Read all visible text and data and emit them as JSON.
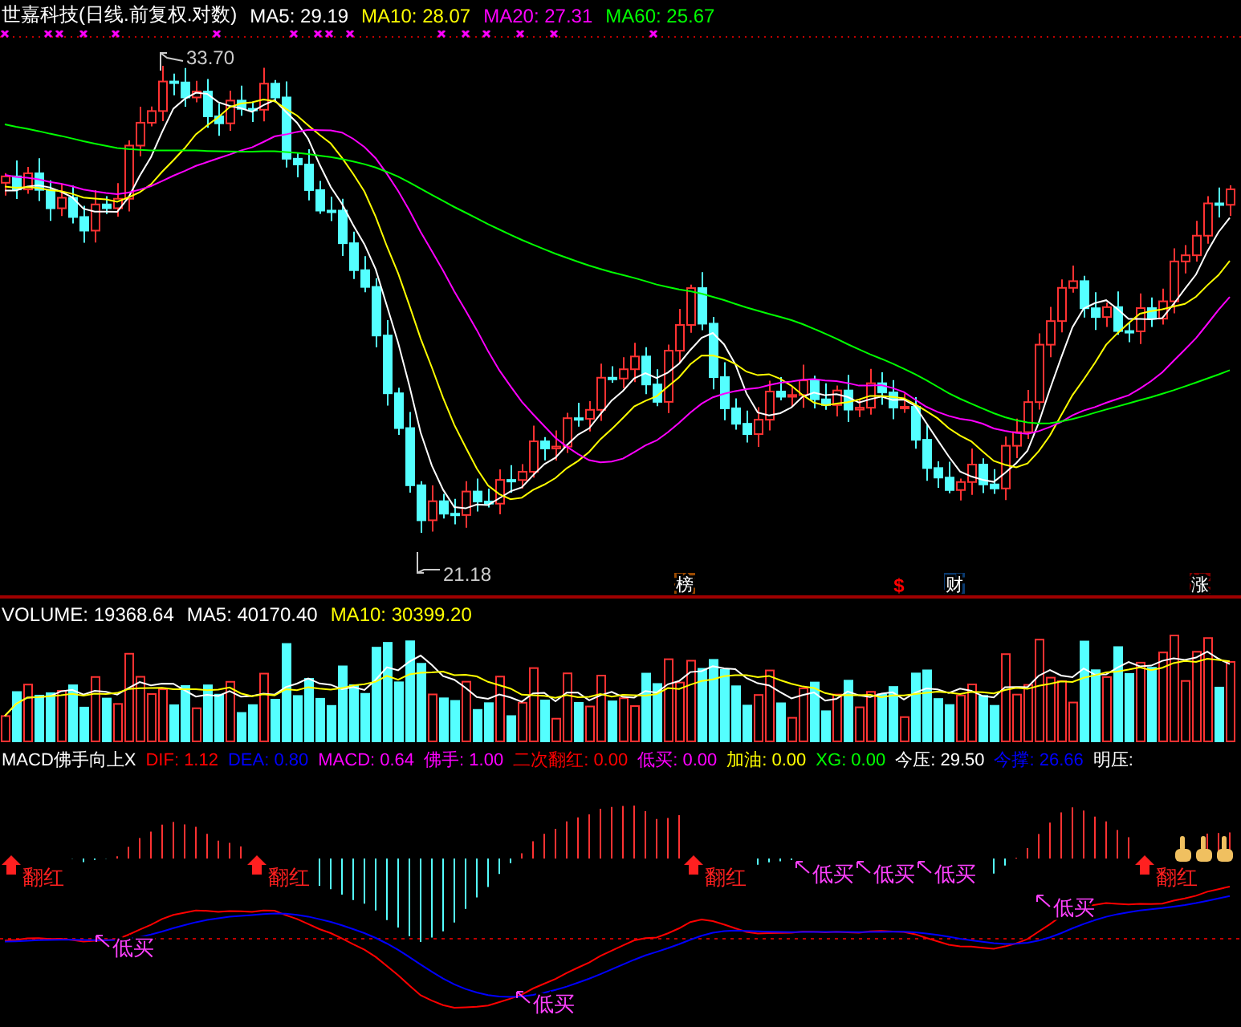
{
  "price_header": {
    "title": "世嘉科技(日线.前复权.对数)",
    "indicators": [
      {
        "label": "MA5: 29.19",
        "color": "#ffffff"
      },
      {
        "label": "MA10: 28.07",
        "color": "#ffff00"
      },
      {
        "label": "MA20: 27.31",
        "color": "#ff00ff"
      },
      {
        "label": "MA60: 25.67",
        "color": "#00ff00"
      }
    ]
  },
  "price_chart": {
    "high_label": "33.70",
    "low_label": "21.18",
    "event_tags": [
      {
        "text": "榜",
        "kind": "box",
        "color": "#9c4a00"
      },
      {
        "text": "$",
        "kind": "plain",
        "color": "#ff0000"
      },
      {
        "text": "财",
        "kind": "box",
        "color": "#0a3a70"
      },
      {
        "text": "涨",
        "kind": "box",
        "color": "#800000"
      }
    ]
  },
  "volume_header": {
    "indicators": [
      {
        "label": "VOLUME: 19368.64",
        "color": "#ffffff"
      },
      {
        "label": "MA5: 40170.40",
        "color": "#ffffff"
      },
      {
        "label": "MA10: 30399.20",
        "color": "#ffff00"
      }
    ]
  },
  "macd_header": {
    "title": "MACD佛手向上X",
    "indicators": [
      {
        "label": "DIF: 1.12",
        "color": "#ff0000"
      },
      {
        "label": "DEA: 0.80",
        "color": "#0000ff"
      },
      {
        "label": "MACD: 0.64",
        "color": "#ff00ff"
      },
      {
        "label": "佛手: 1.00",
        "color": "#ff00ff"
      },
      {
        "label": "二次翻红: 0.00",
        "color": "#ff0000"
      },
      {
        "label": "低买: 0.00",
        "color": "#ff00ff"
      },
      {
        "label": "加油: 0.00",
        "color": "#ffff00"
      },
      {
        "label": "XG: 0.00",
        "color": "#00ff00"
      },
      {
        "label": "今压: 29.50",
        "color": "#ffffff"
      },
      {
        "label": "今撑: 26.66",
        "color": "#0000ff"
      },
      {
        "label": "明压:",
        "color": "#ffffff"
      }
    ]
  },
  "macd_chart": {
    "signals": [
      {
        "text": "翻红",
        "kind": "flip"
      },
      {
        "text": "低买",
        "kind": "buy"
      },
      {
        "text": "翻红",
        "kind": "flip"
      },
      {
        "text": "低买",
        "kind": "buy"
      },
      {
        "text": "翻红",
        "kind": "flip"
      },
      {
        "text": "低买",
        "kind": "buy"
      },
      {
        "text": "低买",
        "kind": "buy"
      },
      {
        "text": "低买",
        "kind": "buy"
      },
      {
        "text": "低买",
        "kind": "buy"
      },
      {
        "text": "翻红",
        "kind": "flip"
      }
    ]
  }
}
